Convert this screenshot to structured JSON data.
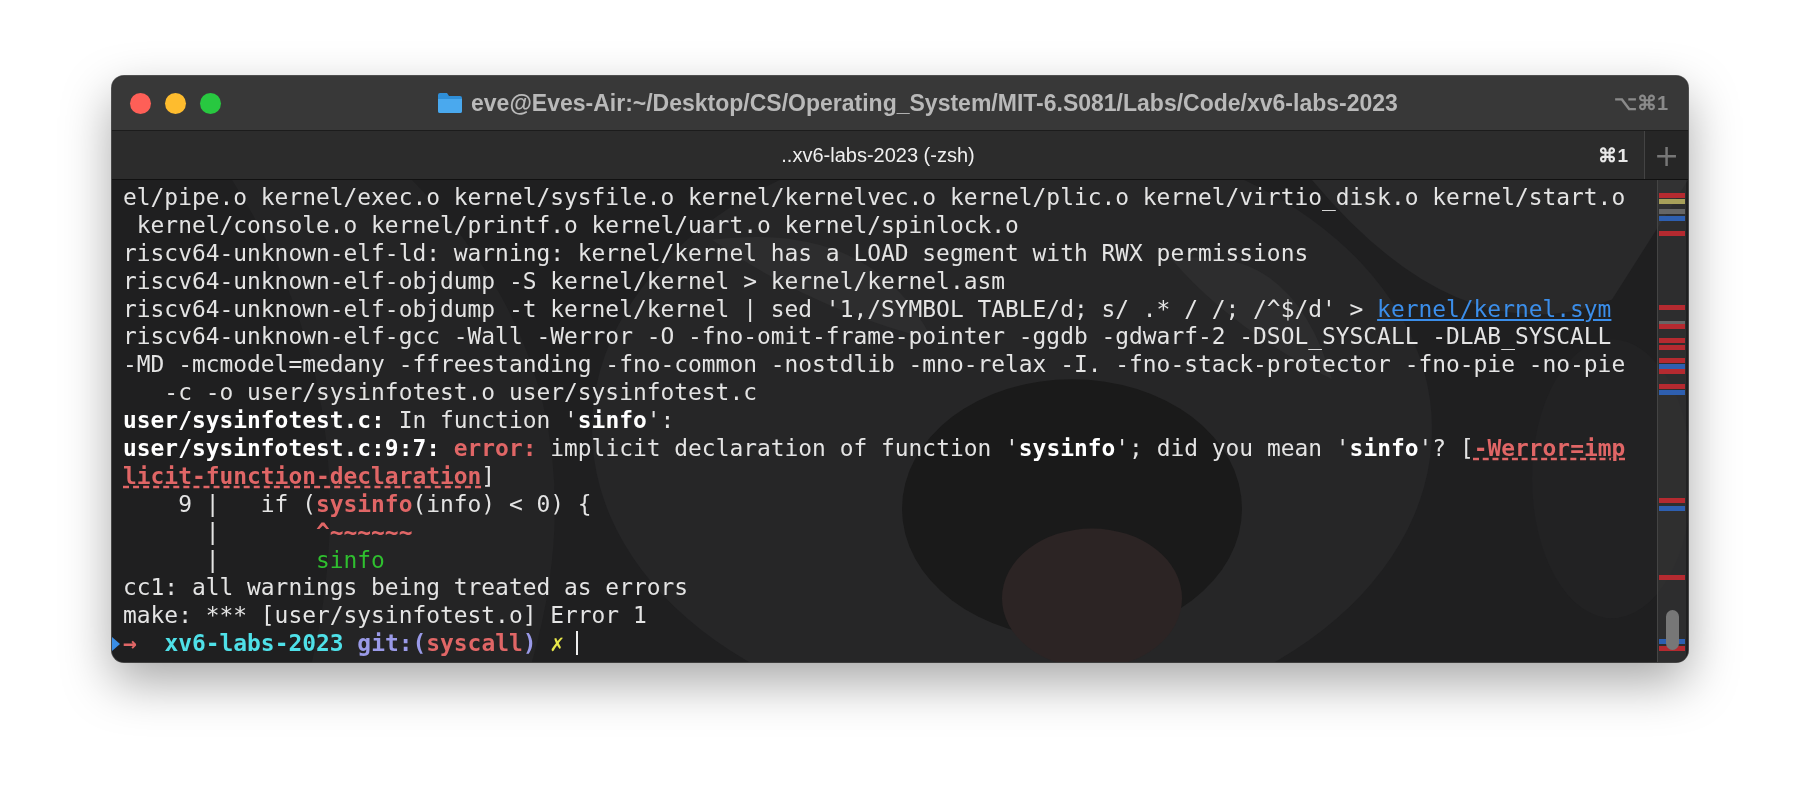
{
  "window": {
    "title": "eve@Eves-Air:~/Desktop/CS/Operating_System/MIT-6.S081/Labs/Code/xv6-labs-2023",
    "shortcut": "⌥⌘1"
  },
  "tabs": [
    {
      "label": "..xv6-labs-2023 (-zsh)",
      "shortcut": "⌘1",
      "selected": true
    }
  ],
  "new_tab": "+",
  "lines": [
    [
      {
        "text": "el/pipe.o kernel/exec.o kernel/sysfile.o kernel/kernelvec.o kernel/plic.o kernel/virtio_disk.o kernel/start.o",
        "kind": "plain"
      }
    ],
    [
      {
        "text": " kernel/console.o kernel/printf.o kernel/uart.o kernel/spinlock.o",
        "kind": "plain"
      }
    ],
    [
      {
        "text": "riscv64-unknown-elf-ld: warning: kernel/kernel has a LOAD segment with RWX permissions",
        "kind": "plain"
      }
    ],
    [
      {
        "text": "riscv64-unknown-elf-objdump -S kernel/kernel > kernel/kernel.asm",
        "kind": "plain"
      }
    ],
    [
      {
        "text": "riscv64-unknown-elf-objdump -t kernel/kernel | sed '1,/SYMBOL TABLE/d; s/ .* / /; /^$/d' > ",
        "kind": "plain"
      },
      {
        "text": "kernel/kernel.sym",
        "kind": "link"
      }
    ],
    [
      {
        "text": "riscv64-unknown-elf-gcc -Wall -Werror -O -fno-omit-frame-pointer -ggdb -gdwarf-2 -DSOL_SYSCALL -DLAB_SYSCALL",
        "kind": "plain"
      }
    ],
    [
      {
        "text": "-MD -mcmodel=medany -ffreestanding -fno-common -nostdlib -mno-relax -I. -fno-stack-protector -fno-pie -no-pie",
        "kind": "plain"
      }
    ],
    [
      {
        "text": "   -c -o user/sysinfotest.o user/sysinfotest.c",
        "kind": "plain"
      }
    ],
    [
      {
        "text": "user/sysinfotest.c:",
        "kind": "bold"
      },
      {
        "text": " In function '",
        "kind": "plain"
      },
      {
        "text": "sinfo",
        "kind": "bold"
      },
      {
        "text": "':",
        "kind": "plain"
      }
    ],
    [
      {
        "text": "user/sysinfotest.c:9:7: ",
        "kind": "bold"
      },
      {
        "text": "error:",
        "kind": "error"
      },
      {
        "text": " implicit declaration of function '",
        "kind": "plain"
      },
      {
        "text": "sysinfo",
        "kind": "bold"
      },
      {
        "text": "'; did you mean '",
        "kind": "plain"
      },
      {
        "text": "sinfo",
        "kind": "bold"
      },
      {
        "text": "'? [",
        "kind": "plain"
      },
      {
        "text": "-Werror=imp",
        "kind": "flag"
      }
    ],
    [
      {
        "text": "licit-function-declaration",
        "kind": "flag"
      },
      {
        "text": "]",
        "kind": "plain"
      }
    ],
    [
      {
        "text": "    9 |   if (",
        "kind": "plain"
      },
      {
        "text": "sysinfo",
        "kind": "error"
      },
      {
        "text": "(info) < 0) {",
        "kind": "plain"
      }
    ],
    [
      {
        "text": "      |       ",
        "kind": "plain"
      },
      {
        "text": "^~~~~~~",
        "kind": "error"
      }
    ],
    [
      {
        "text": "      |       ",
        "kind": "plain"
      },
      {
        "text": "sinfo",
        "kind": "fix"
      }
    ],
    [
      {
        "text": "cc1: all warnings being treated as errors",
        "kind": "plain"
      }
    ],
    [
      {
        "text": "make: *** [user/sysinfotest.o] Error 1",
        "kind": "plain"
      }
    ]
  ],
  "prompt": {
    "arrow": "→",
    "directory": "xv6-labs-2023",
    "git_label": "git:(",
    "branch": "syscall",
    "git_close": ")",
    "dirty": "✗"
  }
}
